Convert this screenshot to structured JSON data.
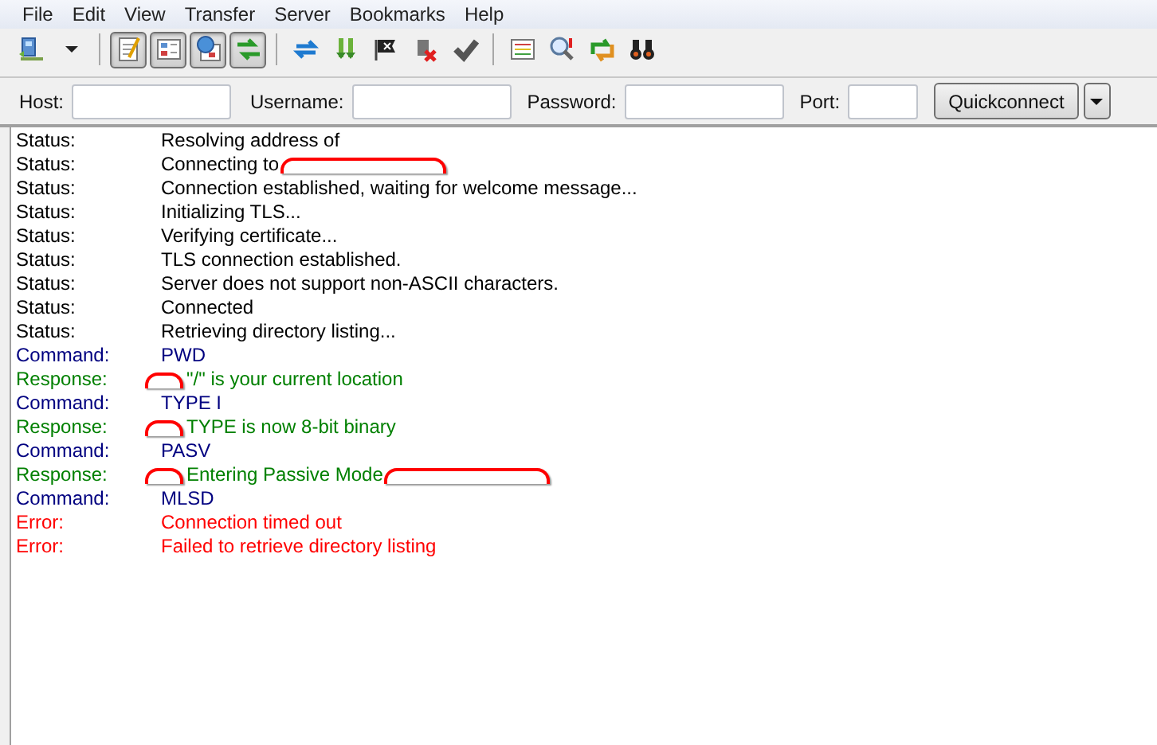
{
  "menu": [
    "File",
    "Edit",
    "View",
    "Transfer",
    "Server",
    "Bookmarks",
    "Help"
  ],
  "toolbar": [
    {
      "kind": "site-manager"
    },
    {
      "kind": "dropdown"
    },
    {
      "kind": "separator"
    },
    {
      "kind": "log",
      "pressed": true
    },
    {
      "kind": "local-tree",
      "pressed": true
    },
    {
      "kind": "remote-tree",
      "pressed": true
    },
    {
      "kind": "queue",
      "pressed": true
    },
    {
      "kind": "separator"
    },
    {
      "kind": "refresh"
    },
    {
      "kind": "process"
    },
    {
      "kind": "cancel"
    },
    {
      "kind": "disconnect"
    },
    {
      "kind": "reconnect"
    },
    {
      "kind": "separator"
    },
    {
      "kind": "filter"
    },
    {
      "kind": "compare"
    },
    {
      "kind": "sync"
    },
    {
      "kind": "find"
    }
  ],
  "quickconnect": {
    "fields": [
      {
        "label": "Host:",
        "kind": "host"
      },
      {
        "label": "Username:",
        "kind": "username"
      },
      {
        "label": "Password:",
        "kind": "password"
      },
      {
        "label": "Port:",
        "kind": "port"
      }
    ],
    "button": "Quickconnect"
  },
  "log": [
    {
      "kind": "status",
      "label": "Status:",
      "text": "Resolving address of"
    },
    {
      "kind": "status",
      "label": "Status:",
      "text": "Connecting to",
      "redaction_after": true
    },
    {
      "kind": "status",
      "label": "Status:",
      "text": "Connection established, waiting for welcome message..."
    },
    {
      "kind": "status",
      "label": "Status:",
      "text": "Initializing TLS..."
    },
    {
      "kind": "status",
      "label": "Status:",
      "text": "Verifying certificate..."
    },
    {
      "kind": "status",
      "label": "Status:",
      "text": "TLS connection established."
    },
    {
      "kind": "status",
      "label": "Status:",
      "text": "Server does not support non-ASCII characters."
    },
    {
      "kind": "status",
      "label": "Status:",
      "text": "Connected"
    },
    {
      "kind": "status",
      "label": "Status:",
      "text": "Retrieving directory listing..."
    },
    {
      "kind": "command",
      "label": "Command:",
      "text": "PWD"
    },
    {
      "kind": "response",
      "label": "Response:",
      "text": "\"/\" is your current location",
      "redaction_before": true
    },
    {
      "kind": "command",
      "label": "Command:",
      "text": "TYPE I"
    },
    {
      "kind": "response",
      "label": "Response:",
      "text": "TYPE is now 8-bit binary",
      "redaction_before": true
    },
    {
      "kind": "command",
      "label": "Command:",
      "text": "PASV"
    },
    {
      "kind": "response",
      "label": "Response:",
      "text": "Entering Passive Mode",
      "redaction_before": true,
      "redaction_after": true
    },
    {
      "kind": "command",
      "label": "Command:",
      "text": "MLSD"
    },
    {
      "kind": "error",
      "label": "Error:",
      "text": "Connection timed out"
    },
    {
      "kind": "error",
      "label": "Error:",
      "text": "Failed to retrieve directory listing"
    }
  ]
}
